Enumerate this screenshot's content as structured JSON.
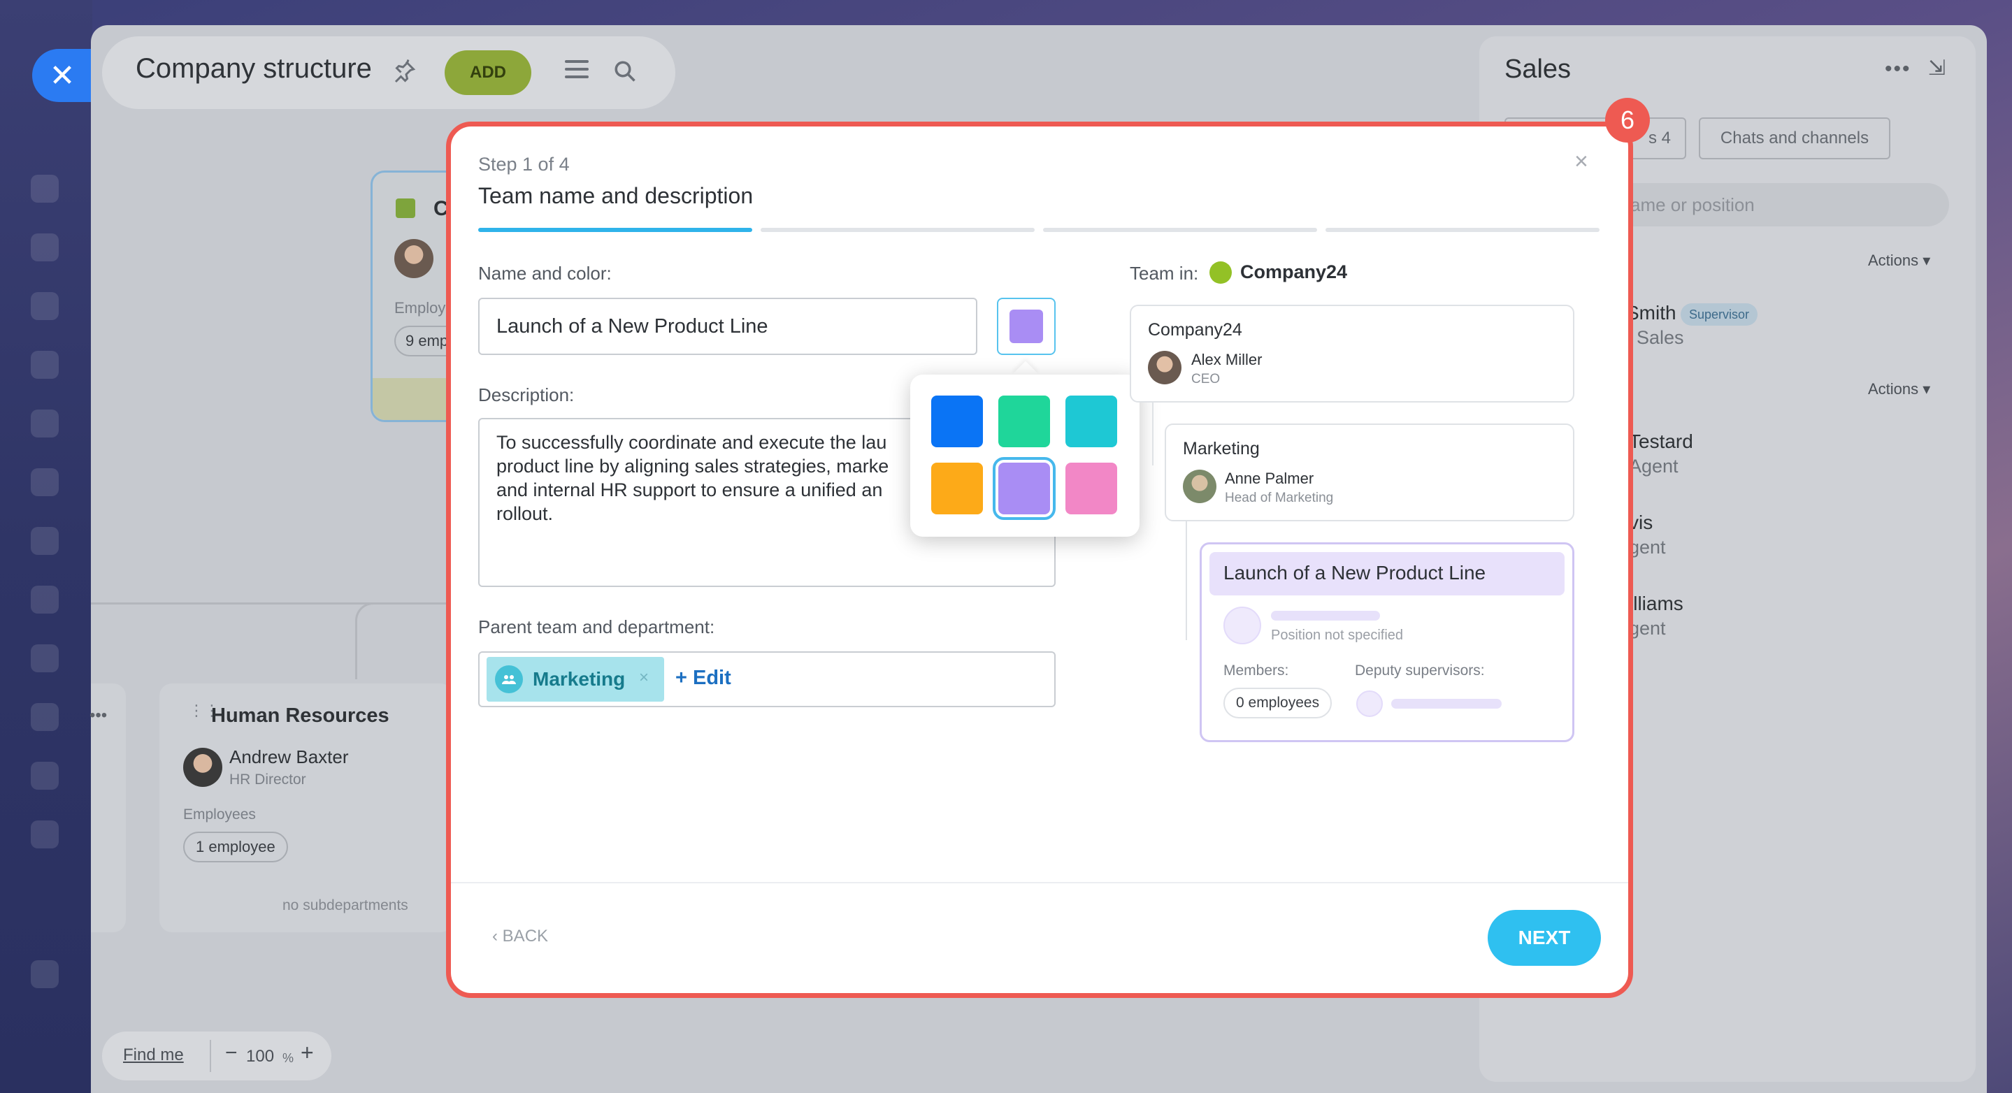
{
  "app": {
    "title": "Company structure",
    "add_label": "ADD"
  },
  "org_card": {
    "title_initial": "C",
    "employees_label": "Employ",
    "employees_count": "9 emp"
  },
  "hr_card": {
    "title": "Human Resources",
    "person_name": "Andrew Baxter",
    "person_position": "HR Director",
    "employees_label": "Employees",
    "employees_count": "1 employee",
    "no_sub": "no subdepartments"
  },
  "zoom": {
    "find_me": "Find me",
    "minus": "−",
    "value": "100",
    "percent": "%",
    "plus": "+"
  },
  "sales": {
    "title": "Sales",
    "tabs": [
      "s 4",
      "Chats and channels"
    ],
    "search_placeholder": "ame or position",
    "actions_label": "Actions",
    "supervisor": {
      "name": "Smith",
      "badge": "Supervisor",
      "role": "f Sales"
    },
    "members": [
      {
        "name": "Testard",
        "role": "Agent"
      },
      {
        "name": "vis",
        "role": "gent"
      },
      {
        "name": "illiams",
        "role": "gent"
      }
    ]
  },
  "modal": {
    "step_badge": "6",
    "close": "×",
    "step_label": "Step 1 of 4",
    "step_title": "Team name and description",
    "progress_current": 1,
    "progress_total": 4,
    "name_label": "Name and color:",
    "name_value": "Launch of a New Product Line",
    "selected_color": "#a98df4",
    "description_label": "Description:",
    "description_lines": [
      "To successfully coordinate and execute the lau",
      "product line by aligning sales strategies, marke",
      "and internal HR support to ensure a unified an",
      "rollout."
    ],
    "palette": [
      "#0a74f5",
      "#1fd69a",
      "#1ec8d4",
      "#fdaa18",
      "#a98df4",
      "#f287c6"
    ],
    "selected_index": 4,
    "parent_label": "Parent team and department:",
    "parent_tag": "Marketing",
    "tag_remove": "×",
    "edit_label": "+ Edit",
    "back_label": "BACK",
    "next_label": "NEXT"
  },
  "preview": {
    "team_in_label": "Team in:",
    "team_in_name": "Company24",
    "company": {
      "title": "Company24",
      "person": "Alex Miller",
      "position": "CEO"
    },
    "marketing": {
      "title": "Marketing",
      "person": "Anne Palmer",
      "position": "Head of Marketing"
    },
    "team": {
      "title": "Launch of a New Product Line",
      "position_placeholder": "Position not specified",
      "members_label": "Members:",
      "deputy_label": "Deputy supervisors:",
      "members_count": "0 employees"
    }
  }
}
